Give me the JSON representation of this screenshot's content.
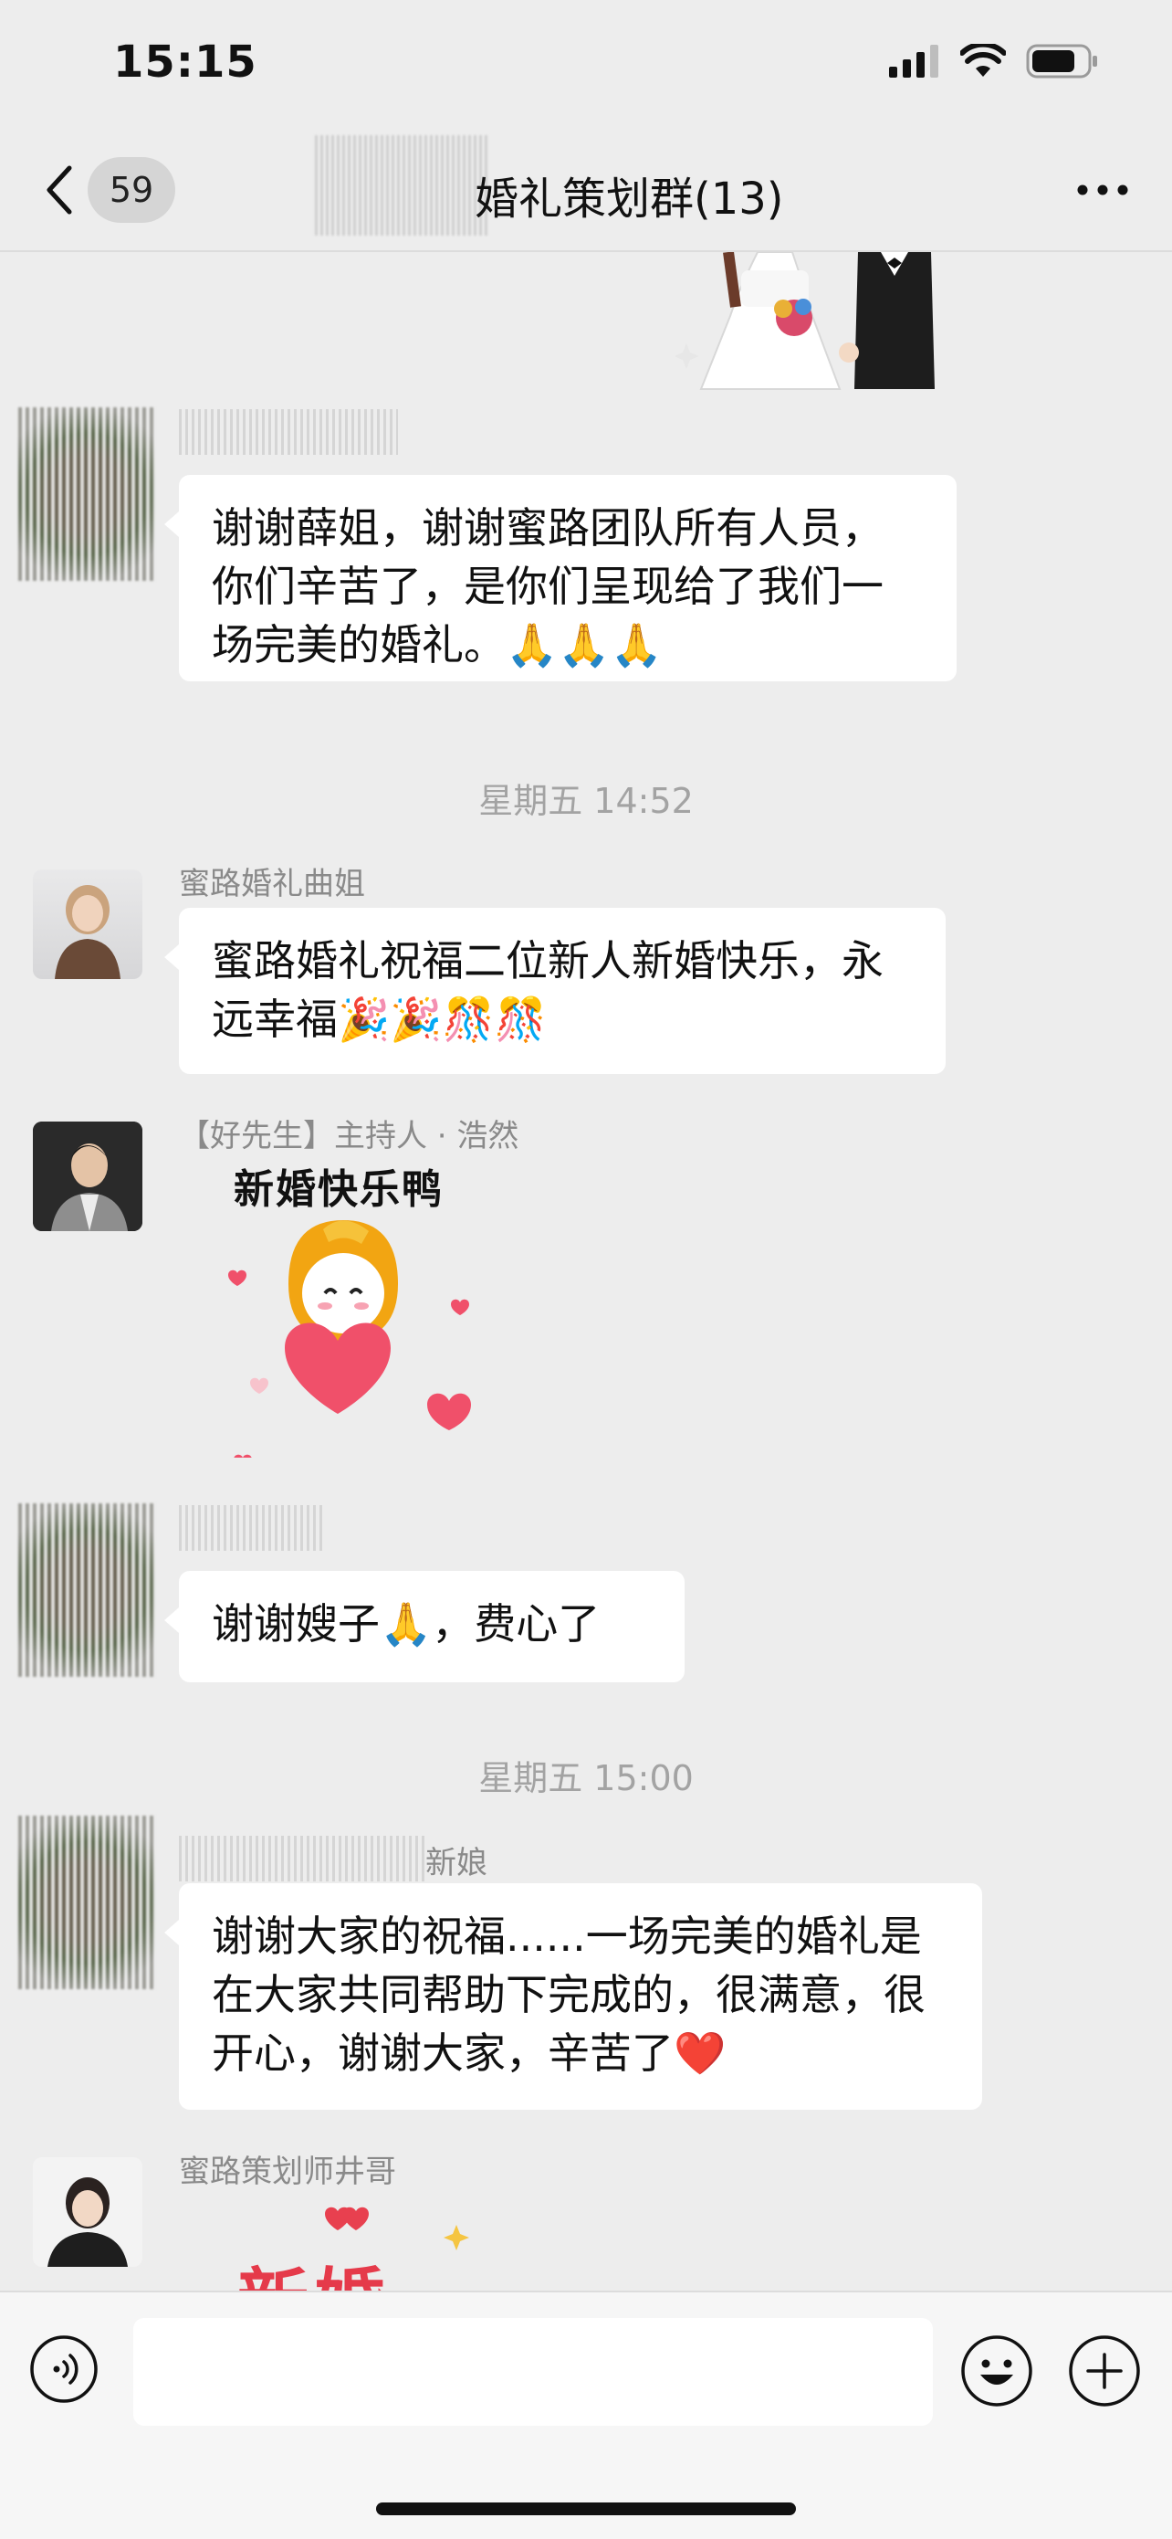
{
  "status_bar": {
    "time": "15:15"
  },
  "nav": {
    "unread_count": "59",
    "title": "婚礼策划群(13)"
  },
  "messages": [
    {
      "type": "text",
      "text": "谢谢薛姐，谢谢蜜路团队所有人员，你们辛苦了，是你们呈现给了我们一场完美的婚礼。🙏🙏🙏"
    },
    {
      "type": "timestamp",
      "text": "星期五 14:52"
    },
    {
      "type": "text",
      "sender": "蜜路婚礼曲姐",
      "text": "蜜路婚礼祝福二位新人新婚快乐，永远幸福🎉🎉🎊🎊"
    },
    {
      "type": "sticker",
      "sender": "【好先生】主持人 · 浩然",
      "sticker_text": "新婚快乐鸭"
    },
    {
      "type": "text",
      "text": "谢谢嫂子🙏，费心了"
    },
    {
      "type": "timestamp",
      "text": "星期五 15:00"
    },
    {
      "type": "text",
      "sender": "新娘",
      "text": "谢谢大家的祝福......一场完美的婚礼是在大家共同帮助下完成的，很满意，很开心，谢谢大家，辛苦了❤️"
    },
    {
      "type": "sticker",
      "sender": "蜜路策划师井哥",
      "sticker_text": "新婚"
    }
  ],
  "colors": {
    "background": "#ededed",
    "bubble": "#ffffff",
    "meta_text": "#a3a3a3"
  }
}
